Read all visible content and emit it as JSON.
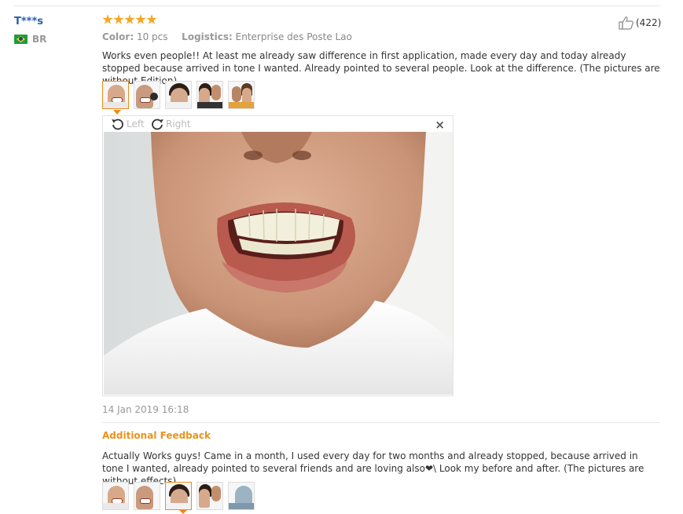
{
  "reviewer": {
    "name": "T***s",
    "country": "BR",
    "flag_icon": "brazil-flag-icon"
  },
  "rating": {
    "stars": 5,
    "max": 5,
    "color": "#f5a623"
  },
  "attributes": {
    "color_label": "Color:",
    "color_value": "10 pcs",
    "logistics_label": "Logistics:",
    "logistics_value": "Enterprise des Poste Lao"
  },
  "helpful": {
    "count": "(422)",
    "icon": "thumbs-up-icon"
  },
  "review_text": "Works even people!! At least me already saw difference in first application, made every day and today already stopped because arrived in tone I wanted. Already pointed to several people. Look at the difference. (The pictures are without Edition)",
  "photos_row1": {
    "count": 5,
    "active_index": 0
  },
  "viewer": {
    "left_label": "Left",
    "right_label": "Right",
    "close_symbol": "×"
  },
  "date": "14 Jan 2019 16:18",
  "additional": {
    "title": "Additional Feedback",
    "text": "Actually Works guys! Came in a month, I used every day for two months and already stopped, because arrived in tone I wanted, already pointed to several friends and are loving also❤\\ Look my before and after. (The pictures are without effects)"
  },
  "photos_row2": {
    "count": 5,
    "active_index": 2
  },
  "colors": {
    "accent": "#f08a1c",
    "link": "#2b5ea8",
    "feedback_title": "#e9941a"
  }
}
